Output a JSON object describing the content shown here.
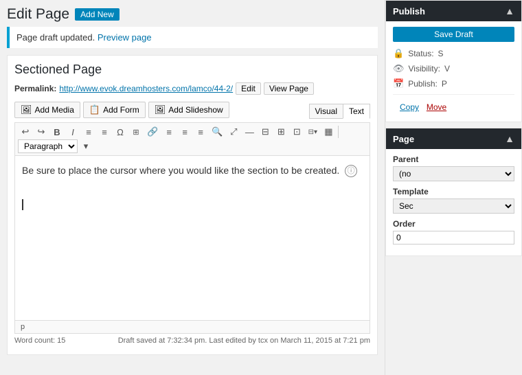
{
  "header": {
    "title": "Edit Page",
    "add_new_label": "Add New"
  },
  "notice": {
    "text": "Page draft updated.",
    "link_text": "Preview page",
    "link_url": "#"
  },
  "editor": {
    "post_title": "Sectioned Page",
    "permalink_label": "Permalink:",
    "permalink_url": "http://www.evok.dreamhosters.com/lamco/44-2/",
    "edit_btn": "Edit",
    "view_page_btn": "View Page",
    "add_media_btn": "Add Media",
    "add_form_btn": "Add Form",
    "add_slideshow_btn": "Add Slideshow",
    "tab_visual": "Visual",
    "tab_text": "Text",
    "editor_content": "Be sure to place the cursor where you would like the section to be created.",
    "status_tag": "p",
    "word_count_label": "Word count:",
    "word_count": "15",
    "draft_status": "Draft saved at 7:32:34 pm. Last edited by tcx on March 11, 2015 at 7:21 pm"
  },
  "toolbar": {
    "buttons": [
      "↩",
      "↪",
      "B",
      "I",
      "≡",
      "≡",
      "Ω",
      "⊞",
      "⛓",
      "≡",
      "≡",
      "≡",
      "🔍",
      "⤢",
      "—",
      "≡",
      "≡",
      "⊞",
      "⊡"
    ],
    "paragraph_select": "Paragraph"
  },
  "sidebar": {
    "publish_panel_title": "Publish",
    "save_btn": "Save Draft",
    "status_label": "Status:",
    "status_value": "S",
    "visibility_label": "Visibility:",
    "visibility_value": "V",
    "schedule_label": "Publish:",
    "schedule_value": "P",
    "copy_link": "Copy",
    "move_link": "Move",
    "page_panel_title": "Page",
    "parent_label": "Parent",
    "parent_default": "(no",
    "template_label": "Template",
    "template_default": "Sec",
    "order_label": "Order"
  }
}
